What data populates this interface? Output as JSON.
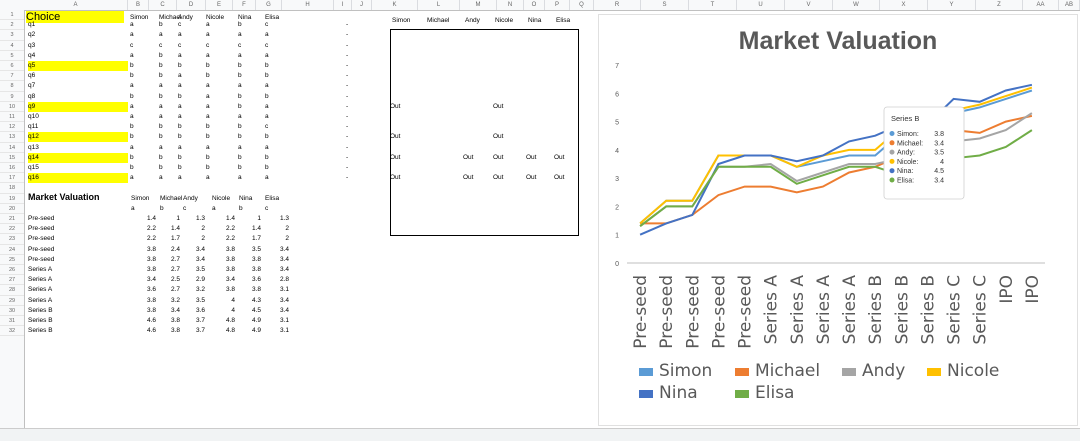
{
  "columns": [
    "A",
    "B",
    "C",
    "D",
    "E",
    "F",
    "G",
    "H",
    "I",
    "J",
    "K",
    "L",
    "M",
    "N",
    "O",
    "P",
    "Q",
    "R",
    "S",
    "T",
    "U",
    "V",
    "W",
    "X",
    "Y",
    "Z",
    "AA",
    "AB"
  ],
  "rows": [
    "1",
    "2",
    "3",
    "4",
    "5",
    "6",
    "7",
    "8",
    "9",
    "10",
    "11",
    "12",
    "13",
    "14",
    "15",
    "16",
    "17",
    "18",
    "19",
    "20",
    "21",
    "22",
    "23",
    "24",
    "25",
    "26",
    "27",
    "28",
    "29",
    "30",
    "31",
    "32"
  ],
  "choice_header": "Choice",
  "people": [
    "Simon",
    "Michael",
    "Andy",
    "Nicole",
    "Nina",
    "Elisa"
  ],
  "questions": [
    {
      "q": "q1",
      "a": [
        "a",
        "b",
        "c",
        "a",
        "b",
        "c"
      ],
      "hl": false,
      "dash": "-"
    },
    {
      "q": "q2",
      "a": [
        "a",
        "a",
        "a",
        "a",
        "a",
        "a"
      ],
      "hl": false,
      "dash": "-"
    },
    {
      "q": "q3",
      "a": [
        "c",
        "c",
        "c",
        "c",
        "c",
        "c"
      ],
      "hl": false,
      "dash": "-"
    },
    {
      "q": "q4",
      "a": [
        "a",
        "b",
        "a",
        "a",
        "a",
        "a"
      ],
      "hl": false,
      "dash": "-"
    },
    {
      "q": "q5",
      "a": [
        "b",
        "b",
        "b",
        "b",
        "b",
        "b"
      ],
      "hl": true,
      "dash": "-"
    },
    {
      "q": "q6",
      "a": [
        "b",
        "b",
        "a",
        "b",
        "b",
        "b"
      ],
      "hl": false,
      "dash": "-"
    },
    {
      "q": "q7",
      "a": [
        "a",
        "a",
        "a",
        "a",
        "a",
        "a"
      ],
      "hl": false,
      "dash": "-"
    },
    {
      "q": "q8",
      "a": [
        "b",
        "b",
        "b",
        "a",
        "b",
        "b"
      ],
      "hl": false,
      "dash": "-"
    },
    {
      "q": "q9",
      "a": [
        "a",
        "a",
        "a",
        "a",
        "b",
        "a"
      ],
      "hl": true,
      "dash": "-"
    },
    {
      "q": "q10",
      "a": [
        "a",
        "a",
        "a",
        "a",
        "a",
        "a"
      ],
      "hl": false,
      "dash": "-"
    },
    {
      "q": "q11",
      "a": [
        "b",
        "b",
        "b",
        "b",
        "b",
        "c"
      ],
      "hl": false,
      "dash": "-"
    },
    {
      "q": "q12",
      "a": [
        "b",
        "b",
        "b",
        "b",
        "b",
        "b"
      ],
      "hl": true,
      "dash": "-"
    },
    {
      "q": "q13",
      "a": [
        "a",
        "a",
        "a",
        "a",
        "a",
        "a"
      ],
      "hl": false,
      "dash": "-"
    },
    {
      "q": "q14",
      "a": [
        "b",
        "b",
        "b",
        "b",
        "b",
        "b"
      ],
      "hl": true,
      "dash": "-"
    },
    {
      "q": "q15",
      "a": [
        "b",
        "b",
        "b",
        "b",
        "b",
        "b"
      ],
      "hl": false,
      "dash": "-"
    },
    {
      "q": "q16",
      "a": [
        "a",
        "a",
        "a",
        "a",
        "a",
        "a"
      ],
      "hl": true,
      "dash": "-"
    }
  ],
  "out_box": {
    "header": [
      "Simon",
      "Michael",
      "Andy",
      "Nicole",
      "Nina",
      "Elisa"
    ],
    "rows": [
      {
        "row": 10,
        "cells": [
          "Out",
          "",
          "",
          "Out",
          "",
          ""
        ]
      },
      {
        "row": 13,
        "cells": [
          "Out",
          "",
          "",
          "Out",
          "",
          ""
        ]
      },
      {
        "row": 15,
        "cells": [
          "Out",
          "",
          "Out",
          "Out",
          "Out",
          "Out"
        ]
      },
      {
        "row": 17,
        "cells": [
          "Out",
          "",
          "Out",
          "Out",
          "Out",
          "Out"
        ]
      }
    ]
  },
  "mv_table": {
    "title": "Market Valuation",
    "header": [
      "Simon",
      "Michael",
      "Andy",
      "Nicole",
      "Nina",
      "Elisa"
    ],
    "subheader": [
      "a",
      "b",
      "c",
      "a",
      "b",
      "c"
    ],
    "rows": [
      {
        "label": "Pre-seed",
        "values": [
          "1.4",
          "1",
          "1.3",
          "1.4",
          "1",
          "1.3"
        ]
      },
      {
        "label": "Pre-seed",
        "values": [
          "2.2",
          "1.4",
          "2",
          "2.2",
          "1.4",
          "2"
        ]
      },
      {
        "label": "Pre-seed",
        "values": [
          "2.2",
          "1.7",
          "2",
          "2.2",
          "1.7",
          "2"
        ]
      },
      {
        "label": "Pre-seed",
        "values": [
          "3.8",
          "2.4",
          "3.4",
          "3.8",
          "3.5",
          "3.4"
        ]
      },
      {
        "label": "Pre-seed",
        "values": [
          "3.8",
          "2.7",
          "3.4",
          "3.8",
          "3.8",
          "3.4"
        ]
      },
      {
        "label": "Series A",
        "values": [
          "3.8",
          "2.7",
          "3.5",
          "3.8",
          "3.8",
          "3.4"
        ]
      },
      {
        "label": "Series A",
        "values": [
          "3.4",
          "2.5",
          "2.9",
          "3.4",
          "3.6",
          "2.8"
        ]
      },
      {
        "label": "Series A",
        "values": [
          "3.6",
          "2.7",
          "3.2",
          "3.8",
          "3.8",
          "3.1"
        ]
      },
      {
        "label": "Series A",
        "values": [
          "3.8",
          "3.2",
          "3.5",
          "4",
          "4.3",
          "3.4"
        ]
      },
      {
        "label": "Series B",
        "values": [
          "3.8",
          "3.4",
          "3.6",
          "4",
          "4.5",
          "3.4"
        ]
      },
      {
        "label": "Series B",
        "values": [
          "4.6",
          "3.8",
          "3.7",
          "4.8",
          "4.9",
          "3.1"
        ]
      },
      {
        "label": "Series B",
        "values": [
          "4.6",
          "3.8",
          "3.7",
          "4.8",
          "4.9",
          "3.1"
        ]
      }
    ]
  },
  "tooltip": {
    "title": "Series B",
    "items": [
      {
        "label": "Simon:",
        "value": "3.8",
        "color": "#5b9bd5"
      },
      {
        "label": "Michael:",
        "value": "3.4",
        "color": "#ed7d31"
      },
      {
        "label": "Andy:",
        "value": "3.5",
        "color": "#a5a5a5"
      },
      {
        "label": "Nicole:",
        "value": "4",
        "color": "#ffc000"
      },
      {
        "label": "Nina:",
        "value": "4.5",
        "color": "#4472c4"
      },
      {
        "label": "Elisa:",
        "value": "3.4",
        "color": "#70ad47"
      }
    ]
  },
  "chart_data": {
    "type": "line",
    "title": "Market Valuation",
    "categories": [
      "Pre-seed",
      "Pre-seed",
      "Pre-seed",
      "Pre-seed",
      "Pre-seed",
      "Series A",
      "Series A",
      "Series A",
      "Series A",
      "Series B",
      "Series B",
      "Series B",
      "Series C",
      "Series C",
      "IPO",
      "IPO"
    ],
    "ylim": [
      0,
      7
    ],
    "yticks": [
      "0",
      "1",
      "2",
      "3",
      "4",
      "5",
      "6",
      "7"
    ],
    "legend_position": "bottom",
    "series": [
      {
        "name": "Simon",
        "color": "#5b9bd5",
        "values": [
          1.4,
          2.2,
          2.2,
          3.8,
          3.8,
          3.8,
          3.4,
          3.6,
          3.8,
          3.8,
          4.6,
          4.6,
          5.3,
          5.5,
          5.8,
          6.1
        ]
      },
      {
        "name": "Michael",
        "color": "#ed7d31",
        "values": [
          1.4,
          1.4,
          1.7,
          2.4,
          2.7,
          2.7,
          2.5,
          2.7,
          3.2,
          3.4,
          3.8,
          3.8,
          4.7,
          4.6,
          5.0,
          5.2
        ]
      },
      {
        "name": "Andy",
        "color": "#a5a5a5",
        "values": [
          1.3,
          2.0,
          2.0,
          3.4,
          3.4,
          3.5,
          2.9,
          3.2,
          3.5,
          3.5,
          3.7,
          3.7,
          4.3,
          4.4,
          4.7,
          5.3
        ]
      },
      {
        "name": "Nicole",
        "color": "#ffc000",
        "values": [
          1.4,
          2.2,
          2.2,
          3.8,
          3.8,
          3.8,
          3.4,
          3.8,
          4.0,
          4.0,
          4.8,
          4.8,
          5.4,
          5.6,
          5.9,
          6.2
        ]
      },
      {
        "name": "Nina",
        "color": "#4472c4",
        "values": [
          1.0,
          1.4,
          1.7,
          3.5,
          3.8,
          3.8,
          3.6,
          3.8,
          4.3,
          4.5,
          4.9,
          4.9,
          5.8,
          5.7,
          6.1,
          6.3
        ]
      },
      {
        "name": "Elisa",
        "color": "#70ad47",
        "values": [
          1.3,
          2.0,
          2.0,
          3.4,
          3.4,
          3.4,
          2.8,
          3.1,
          3.4,
          3.4,
          3.1,
          3.1,
          3.7,
          3.8,
          4.1,
          4.7
        ]
      }
    ]
  }
}
